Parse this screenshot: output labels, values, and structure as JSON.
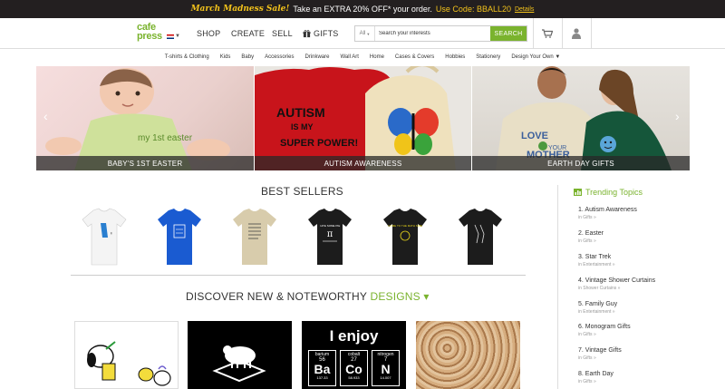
{
  "promo": {
    "headline": "March Madness Sale!",
    "text": "Take an EXTRA 20% OFF* your order.",
    "code": "Use Code: BBALL20",
    "details": "Details"
  },
  "header": {
    "logo_line1": "cafe",
    "logo_line2": "press",
    "nav": [
      "SHOP",
      "CREATE",
      "SELL",
      "GIFTS"
    ],
    "search_scope": "All",
    "search_placeholder": "Search your interests",
    "search_button": "SEARCH",
    "icons": [
      "cart-icon",
      "user-icon",
      "gift-icon"
    ]
  },
  "categories": [
    "T-shirts & Clothing",
    "Kids",
    "Baby",
    "Accessories",
    "Drinkware",
    "Wall Art",
    "Home",
    "Cases & Covers",
    "Hobbies",
    "Stationery",
    "Design Your Own ▼"
  ],
  "hero": [
    {
      "caption": "BABY'S 1ST EASTER",
      "art_text": "my 1st easter"
    },
    {
      "caption": "AUTISM AWARENESS",
      "art_text": "AUTISM IS MY SUPER POWER!"
    },
    {
      "caption": "EARTH DAY GIFTS",
      "art_text": "LOVE YOUR MOTHER"
    }
  ],
  "best_sellers": {
    "title": "BEST SELLERS",
    "shirts": [
      {
        "color": "#f4f4f4"
      },
      {
        "color": "#1a5bd1"
      },
      {
        "color": "#d8ccac"
      },
      {
        "color": "#1c1c1c",
        "print": "I ATE SOME PIE"
      },
      {
        "color": "#1c1c1c",
        "print": "COME TO THE MATH SIDE"
      },
      {
        "color": "#1c1c1c"
      }
    ]
  },
  "discover": {
    "prefix": "DISCOVER NEW & NOTEWORTHY",
    "accent": "DESIGNS",
    "caret": "▾",
    "tiles": [
      {
        "bg": "#ffffff"
      },
      {
        "bg": "#000000"
      },
      {
        "bg": "#000000",
        "headline": "I enjoy",
        "elements": [
          {
            "name": "barium",
            "num": "56",
            "sym": "Ba",
            "mass": "137.33"
          },
          {
            "name": "cobalt",
            "num": "27",
            "sym": "Co",
            "mass": "58.933"
          },
          {
            "name": "nitrogen",
            "num": "7",
            "sym": "N",
            "mass": "14.007"
          }
        ]
      },
      {
        "bg": "#c79a6c"
      }
    ]
  },
  "trending": {
    "title": "Trending Topics",
    "items": [
      {
        "title": "1. Autism Awareness",
        "sub": "in Gifts »"
      },
      {
        "title": "2. Easter",
        "sub": "in Gifts »"
      },
      {
        "title": "3. Star Trek",
        "sub": "in Entertainment »"
      },
      {
        "title": "4. Vintage Shower Curtains",
        "sub": "in Shower Curtains »"
      },
      {
        "title": "5. Family Guy",
        "sub": "in Entertainment »"
      },
      {
        "title": "6. Monogram Gifts",
        "sub": "in Gifts »"
      },
      {
        "title": "7. Vintage Gifts",
        "sub": "in Gifts »"
      },
      {
        "title": "8. Earth Day",
        "sub": "in Gifts »"
      }
    ]
  },
  "colors": {
    "brand_green": "#7ab32e",
    "promo_yellow": "#f2c21b",
    "promo_bg": "#231f20"
  }
}
